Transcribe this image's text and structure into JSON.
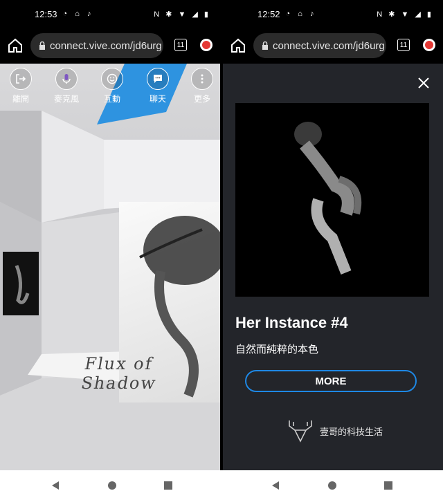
{
  "left": {
    "status": {
      "time": "12:53"
    },
    "browser": {
      "url": "connect.vive.com/jd6urg",
      "tab_count": "11"
    },
    "toolbar": [
      {
        "label": "離開",
        "icon": "exit-icon"
      },
      {
        "label": "麥克風",
        "icon": "microphone-icon"
      },
      {
        "label": "互動",
        "icon": "smiley-icon"
      },
      {
        "label": "聊天",
        "icon": "chat-icon"
      },
      {
        "label": "更多",
        "icon": "more-icon"
      }
    ],
    "floor_text": "Flux of Shadow"
  },
  "right": {
    "status": {
      "time": "12:52"
    },
    "browser": {
      "url": "connect.vive.com/jd6urg",
      "tab_count": "11"
    },
    "panel": {
      "title": "Her Instance #4",
      "subtitle": "自然而純粹的本色",
      "more_label": "MORE",
      "brand": "壹哥的科技生活"
    }
  },
  "colors": {
    "accent": "#1e88e5",
    "panel_bg": "#23252a",
    "update_badge": "#e53935"
  }
}
